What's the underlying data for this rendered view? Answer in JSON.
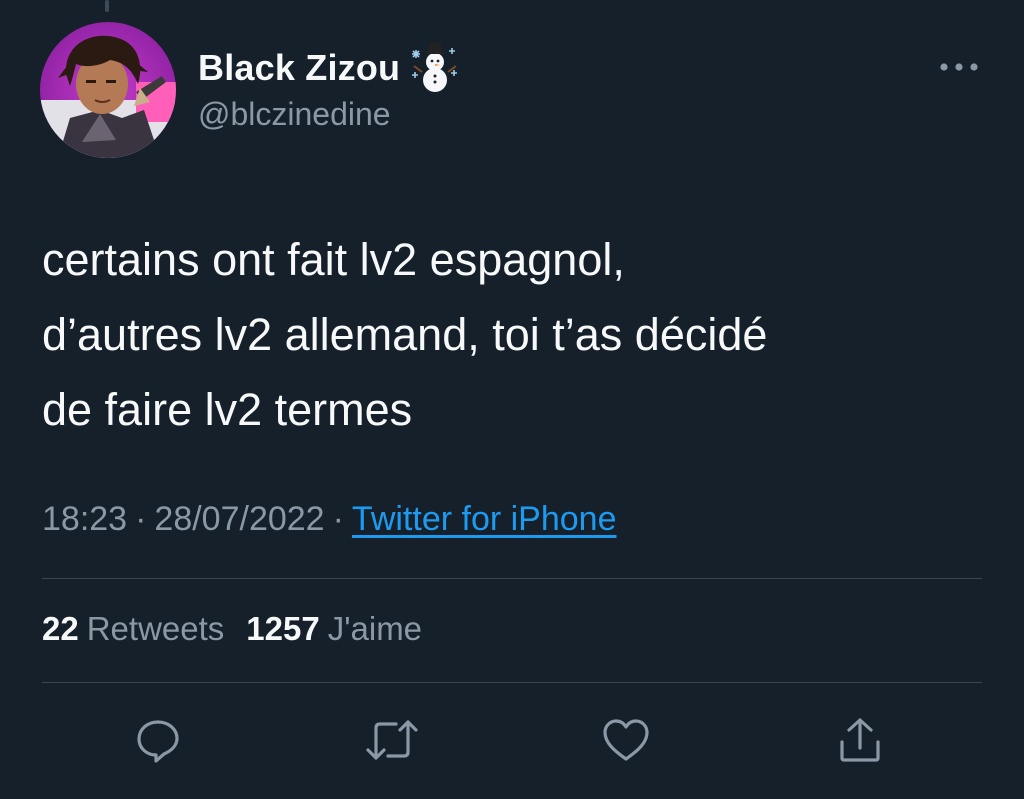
{
  "tweet": {
    "author": {
      "display_name": "Black Zizou",
      "handle": "@blczinedine",
      "badge_icon": "snowman-icon"
    },
    "text_lines": [
      "certains ont fait lv2 espagnol,",
      "d’autres lv2 allemand, toi t’as décidé",
      "de faire lv2 termes"
    ],
    "time": "18:23",
    "date": "28/07/2022",
    "separator": "·",
    "source": "Twitter for iPhone",
    "stats": {
      "retweets_count": "22",
      "retweets_label": "Retweets",
      "likes_count": "1257",
      "likes_label": "J'aime"
    },
    "actions": [
      "reply-icon",
      "retweet-icon",
      "like-icon",
      "share-icon"
    ]
  },
  "colors": {
    "background": "#15202b",
    "text_primary": "#f7f9f9",
    "text_secondary": "#8b98a5",
    "link": "#1d9bf0",
    "divider": "#38444d"
  }
}
